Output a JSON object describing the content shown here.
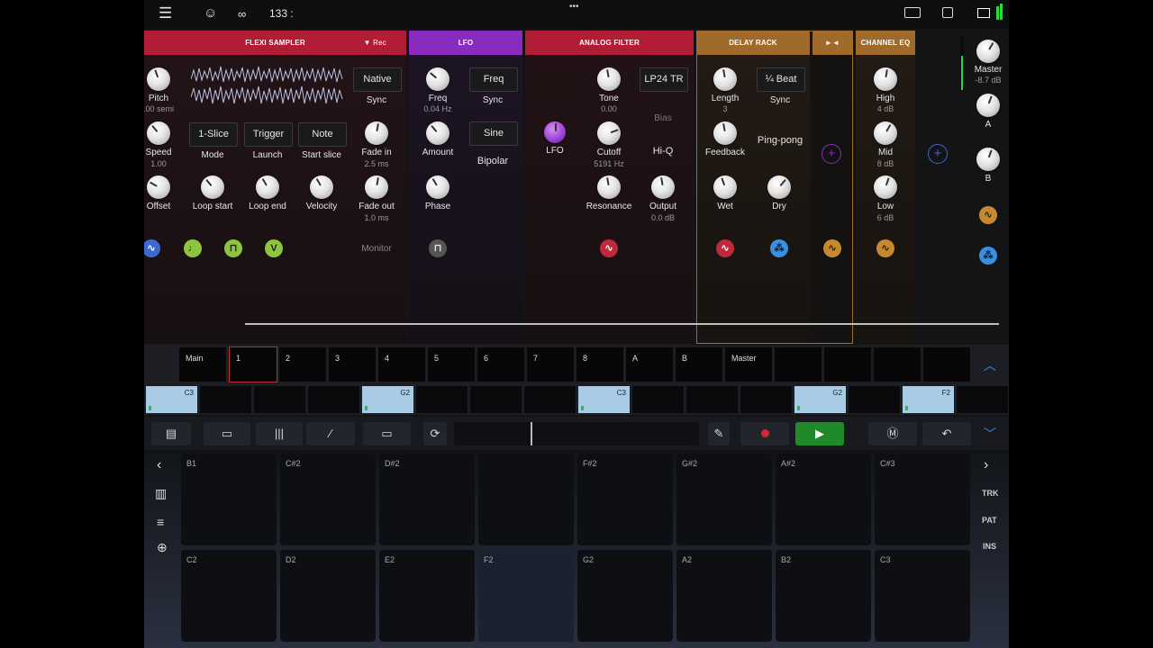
{
  "topbar": {
    "tempo": "133 :",
    "menu_icon": "hamburger-icon",
    "metronome_icon": "smiley-icon",
    "loop_icon": "tape-loop-icon"
  },
  "modules": {
    "flexi": {
      "title": "Flexi sampler",
      "rec": "▼ Rec",
      "color": "#b11d35",
      "pitch_label": "Pitch",
      "pitch_value": ".00 semi",
      "native": "Native",
      "sync": "Sync",
      "speed_label": "Speed",
      "speed_value": "1.00",
      "mode_box": "1-Slice",
      "mode_label": "Mode",
      "launch_box": "Trigger",
      "launch_label": "Launch",
      "startslice_box": "Note",
      "startslice_label": "Start slice",
      "fadein_label": "Fade in",
      "fadein_value": "2.5 ms",
      "offset_label": "Offset",
      "loopstart_label": "Loop start",
      "loopend_label": "Loop end",
      "velocity_label": "Velocity",
      "fadeout_label": "Fade out",
      "fadeout_value": "1.0 ms",
      "monitor": "Monitor"
    },
    "lfo": {
      "title": "LFO",
      "color": "#8a2bc0",
      "freq_label": "Freq",
      "freq_value": "0.04 Hz",
      "freq_box": "Freq",
      "sync": "Sync",
      "amount_label": "Amount",
      "shape_box": "Sine",
      "bipolar": "Bipolar",
      "phase_label": "Phase"
    },
    "filter": {
      "title": "Analog filter",
      "color": "#b11d35",
      "lfo_label": "LFO",
      "tone_label": "Tone",
      "tone_value": "0.00",
      "type_box": "LP24 TR",
      "bias": "Bias",
      "cutoff_label": "Cutoff",
      "cutoff_value": "5191 Hz",
      "hiq": "Hi-Q",
      "resonance_label": "Resonance",
      "output_label": "Output",
      "output_value": "0.0 dB"
    },
    "delay": {
      "title": "Delay rack",
      "color": "#a06a2a",
      "length_label": "Length",
      "length_value": "3",
      "beat_box": "¼ Beat",
      "sync": "Sync",
      "feedback_label": "Feedback",
      "pingpong": "Ping-pong",
      "wet_label": "Wet",
      "dry_label": "Dry"
    },
    "mini": {
      "title": "►◄",
      "color": "#a06a2a"
    },
    "eq": {
      "title": "Channel EQ",
      "color": "#a06a2a",
      "high_label": "High",
      "high_value": "4 dB",
      "mid_label": "Mid",
      "mid_value": "8 dB",
      "low_label": "Low",
      "low_value": "6 dB"
    },
    "master": {
      "master_label": "Master",
      "master_value": "-8.7 dB",
      "a_label": "A",
      "b_label": "B"
    }
  },
  "tracks": [
    "Main",
    "1",
    "2",
    "3",
    "4",
    "5",
    "6",
    "7",
    "8",
    "A",
    "B",
    "Master",
    "",
    "",
    "",
    ""
  ],
  "patterns": [
    {
      "label": "C3",
      "on": true
    },
    {
      "label": "",
      "on": false
    },
    {
      "label": "",
      "on": false
    },
    {
      "label": "",
      "on": false
    },
    {
      "label": "G2",
      "on": true
    },
    {
      "label": "",
      "on": false
    },
    {
      "label": "",
      "on": false
    },
    {
      "label": "",
      "on": false
    },
    {
      "label": "C3",
      "on": true
    },
    {
      "label": "",
      "on": false
    },
    {
      "label": "",
      "on": false
    },
    {
      "label": "",
      "on": false
    },
    {
      "label": "G2",
      "on": true
    },
    {
      "label": "",
      "on": false
    },
    {
      "label": "F2",
      "on": true
    },
    {
      "label": "",
      "on": false
    }
  ],
  "pads_row1": [
    "B1",
    "C#2",
    "D#2",
    "",
    "F#2",
    "G#2",
    "A#2",
    "C#3"
  ],
  "pads_row2": [
    "C2",
    "D2",
    "E2",
    "F2",
    "G2",
    "A2",
    "B2",
    "C3"
  ],
  "right_side": [
    "TRK",
    "PAT",
    "INS"
  ],
  "colors": {
    "play": "#1e8a2a",
    "record": "#d0283a",
    "accent": "#3a8fe0"
  }
}
